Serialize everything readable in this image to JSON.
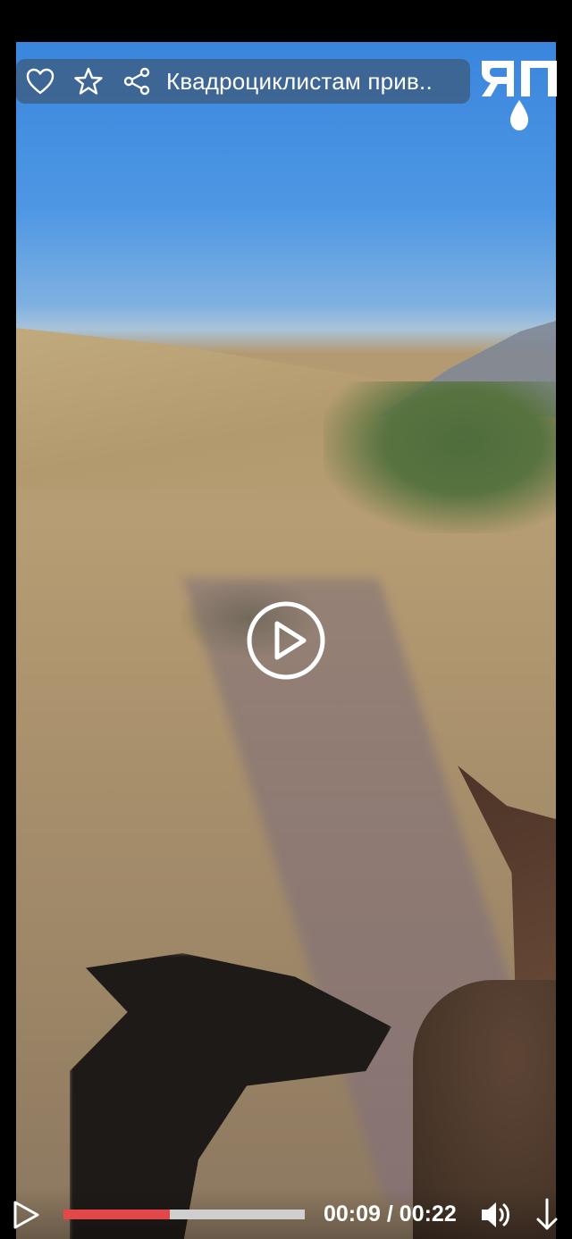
{
  "player": {
    "title": "Квадроциклистам прив..",
    "current_time": "00:09",
    "separator": " / ",
    "duration": "00:22",
    "progress_fraction": 0.44,
    "logo_text": "ЯП"
  },
  "icons": {
    "like": "heart-icon",
    "favorite": "star-icon",
    "share": "share-icon",
    "play_center": "play-circle-icon",
    "play": "play-icon",
    "volume": "volume-icon",
    "download": "download-icon"
  },
  "colors": {
    "progress_played": "#e2484a",
    "progress_track": "#cfcfcf",
    "overlay_bar": "rgba(60,72,88,.55)"
  }
}
